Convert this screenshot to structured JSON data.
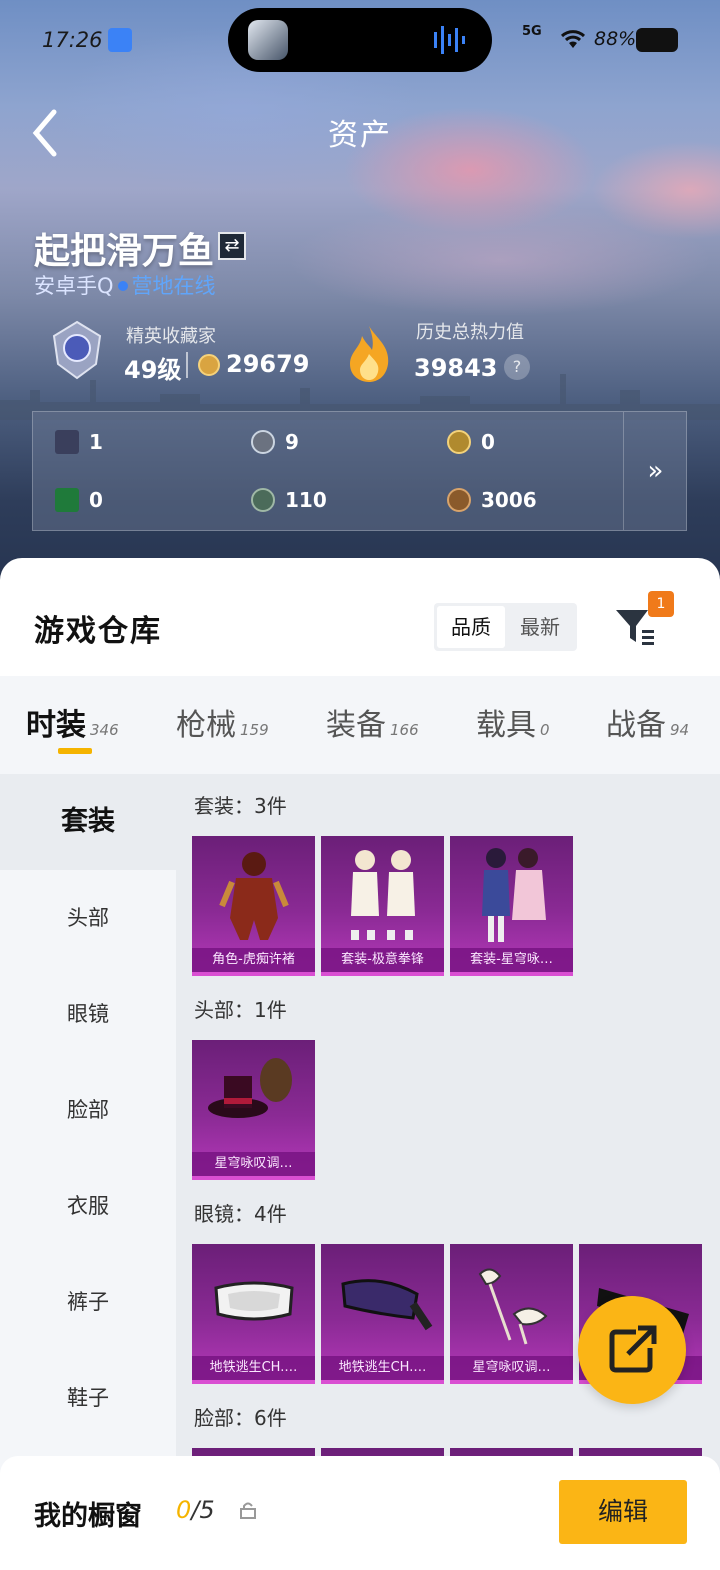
{
  "status_bar": {
    "time": "17:26",
    "network": "5G",
    "battery": "88%"
  },
  "header": {
    "title": "资产"
  },
  "profile": {
    "name": "起把滑万鱼",
    "platform": "安卓手Q",
    "status": "营地在线",
    "rank_label": "精英收藏家",
    "rank_level": "49级",
    "coins": "29679",
    "heat_label": "历史总热力值",
    "heat_value": "39843",
    "help": "?"
  },
  "currencies": [
    {
      "icon": "card-icon",
      "value": "1",
      "color": "#3a3f5c"
    },
    {
      "icon": "silver-token-icon",
      "value": "9",
      "color": "#6b7280"
    },
    {
      "icon": "gold-token-icon",
      "value": "0",
      "color": "#b08a2e"
    },
    {
      "icon": "green-card-icon",
      "value": "0",
      "color": "#1f7a3a"
    },
    {
      "icon": "green-orb-icon",
      "value": "110",
      "color": "#4b6b5a"
    },
    {
      "icon": "bronze-coin-icon",
      "value": "3006",
      "color": "#8a5a2b"
    }
  ],
  "warehouse": {
    "title": "游戏仓库",
    "sort_quality": "品质",
    "sort_latest": "最新",
    "filter_badge": "1"
  },
  "tabs": [
    {
      "label": "时装",
      "count": "346"
    },
    {
      "label": "枪械",
      "count": "159"
    },
    {
      "label": "装备",
      "count": "166"
    },
    {
      "label": "载具",
      "count": "0"
    },
    {
      "label": "战备",
      "count": "94"
    }
  ],
  "sidebar": [
    "套装",
    "头部",
    "眼镜",
    "脸部",
    "衣服",
    "裤子",
    "鞋子"
  ],
  "sections": [
    {
      "label": "套装：3件",
      "items": [
        "角色-虎痴许褚",
        "套装-极意拳锋",
        "套装-星穹咏…"
      ]
    },
    {
      "label": "头部：1件",
      "items": [
        "星穹咏叹调…"
      ]
    },
    {
      "label": "眼镜：4件",
      "items": [
        "地铁逃生CH.…",
        "地铁逃生CH.…",
        "星穹咏叹调…",
        ""
      ]
    },
    {
      "label": "脸部：6件",
      "items": []
    }
  ],
  "bottom_bar": {
    "showcase_label": "我的橱窗",
    "showcase_current": "0",
    "showcase_total": "/5",
    "edit_label": "编辑"
  },
  "colors": {
    "accent": "#fbb515",
    "item_purple": "#8a2a94",
    "badge_orange": "#f07a1a",
    "online_blue": "#60a5fa"
  }
}
